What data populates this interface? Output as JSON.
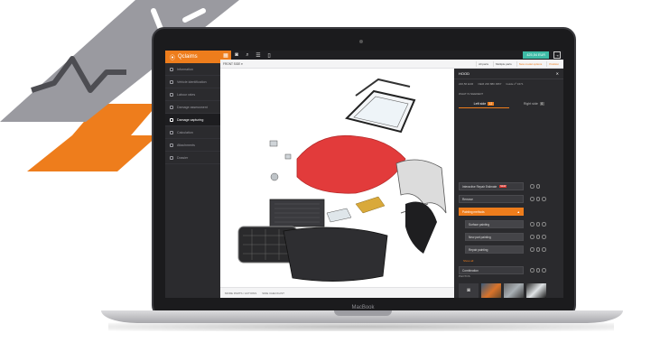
{
  "colors": {
    "brand_orange": "#ee7d1c",
    "dark_bg": "#2b2b2e",
    "price_teal": "#3dbba6",
    "hood_red": "#e23b3b",
    "deco_gray": "#9a9aa0"
  },
  "laptop": {
    "brand": "MacBook"
  },
  "app": {
    "logo": "Qclaims",
    "sidebar": {
      "items": [
        {
          "label": "Information",
          "icon": "info-icon"
        },
        {
          "label": "Vehicle identification",
          "icon": "car-icon"
        },
        {
          "label": "Labour rates",
          "icon": "clock-icon"
        },
        {
          "label": "Damage assessment",
          "icon": "clipboard-icon"
        },
        {
          "label": "Damage capturing",
          "icon": "wrench-icon",
          "active": true
        },
        {
          "label": "Calculation",
          "icon": "calculator-icon"
        },
        {
          "label": "Attachments",
          "icon": "paperclip-icon"
        },
        {
          "label": "Dossier",
          "icon": "folder-icon"
        }
      ]
    },
    "toolbar": {
      "icons": [
        "grid-icon",
        "camera-icon",
        "search-icon",
        "parts-icon",
        "document-icon"
      ],
      "price": "425,54 EUR",
      "exit_icon": "exit-icon"
    },
    "subbar": {
      "view_label": "FRONT SIDE ▾",
      "tabs": [
        "All parts",
        "Multiple parts",
        "New model options",
        "Position"
      ]
    },
    "bottombar": {
      "items": [
        "MORE PARTS / ACTIONS",
        "SIDE CHECKLIST"
      ]
    },
    "panel": {
      "title": "HOOD",
      "close": "✕",
      "codes": [
        "226,56 EUR",
        "OEM 236 880 3957",
        "Guide nº 3471"
      ],
      "question": "WHAT IS NEEDED?",
      "sides": [
        {
          "label": "Left side",
          "count": "12",
          "active": true
        },
        {
          "label": "Right side",
          "count": "0"
        }
      ],
      "operations": [
        {
          "label": "Interactive Repair Estimate",
          "badge": "NEW"
        },
        {
          "label": "Remove"
        },
        {
          "label": "Painting methods",
          "highlight": true
        },
        {
          "label": "Surface painting",
          "sub": true
        },
        {
          "label": "New part painting",
          "sub": true
        },
        {
          "label": "Repair painting",
          "sub": true
        },
        {
          "label": "Combination"
        }
      ],
      "show_all": "Show all",
      "photos_label": "PHOTOS",
      "add_photo_icon": "camera-icon"
    }
  }
}
